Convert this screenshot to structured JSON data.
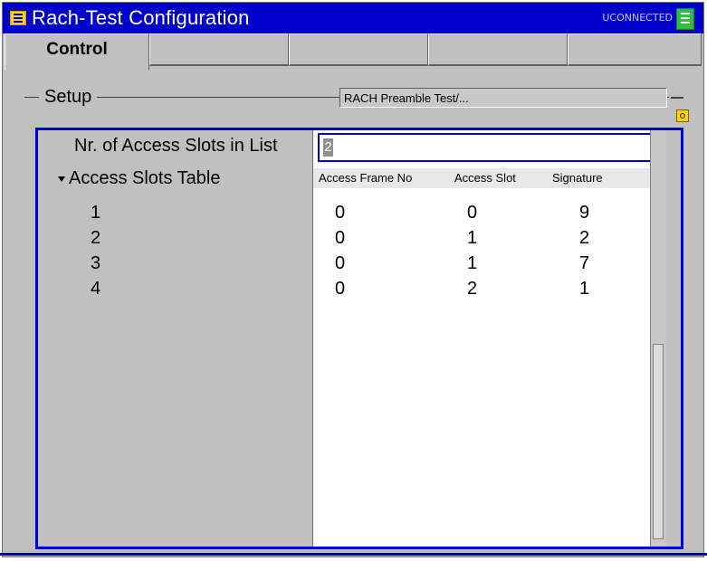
{
  "window": {
    "title": "Rach-Test Configuration",
    "status": "UCONNECTED"
  },
  "tabs": [
    "Control",
    "",
    "",
    "",
    ""
  ],
  "setup": {
    "label": "Setup",
    "test_scope": "RACH Preamble Test/..."
  },
  "params": {
    "access_slots_label": "Nr. of Access Slots in List",
    "access_slots_value": "2",
    "table_label": "Access Slots Table"
  },
  "table": {
    "headers": [
      "Access Frame No",
      "Access Slot",
      "Signature"
    ],
    "rows": [
      {
        "index": "1",
        "frame": "0",
        "slot": "0",
        "signature": "9"
      },
      {
        "index": "2",
        "frame": "0",
        "slot": "1",
        "signature": "2"
      },
      {
        "index": "3",
        "frame": "0",
        "slot": "1",
        "signature": "7"
      },
      {
        "index": "4",
        "frame": "0",
        "slot": "2",
        "signature": "1"
      }
    ]
  }
}
